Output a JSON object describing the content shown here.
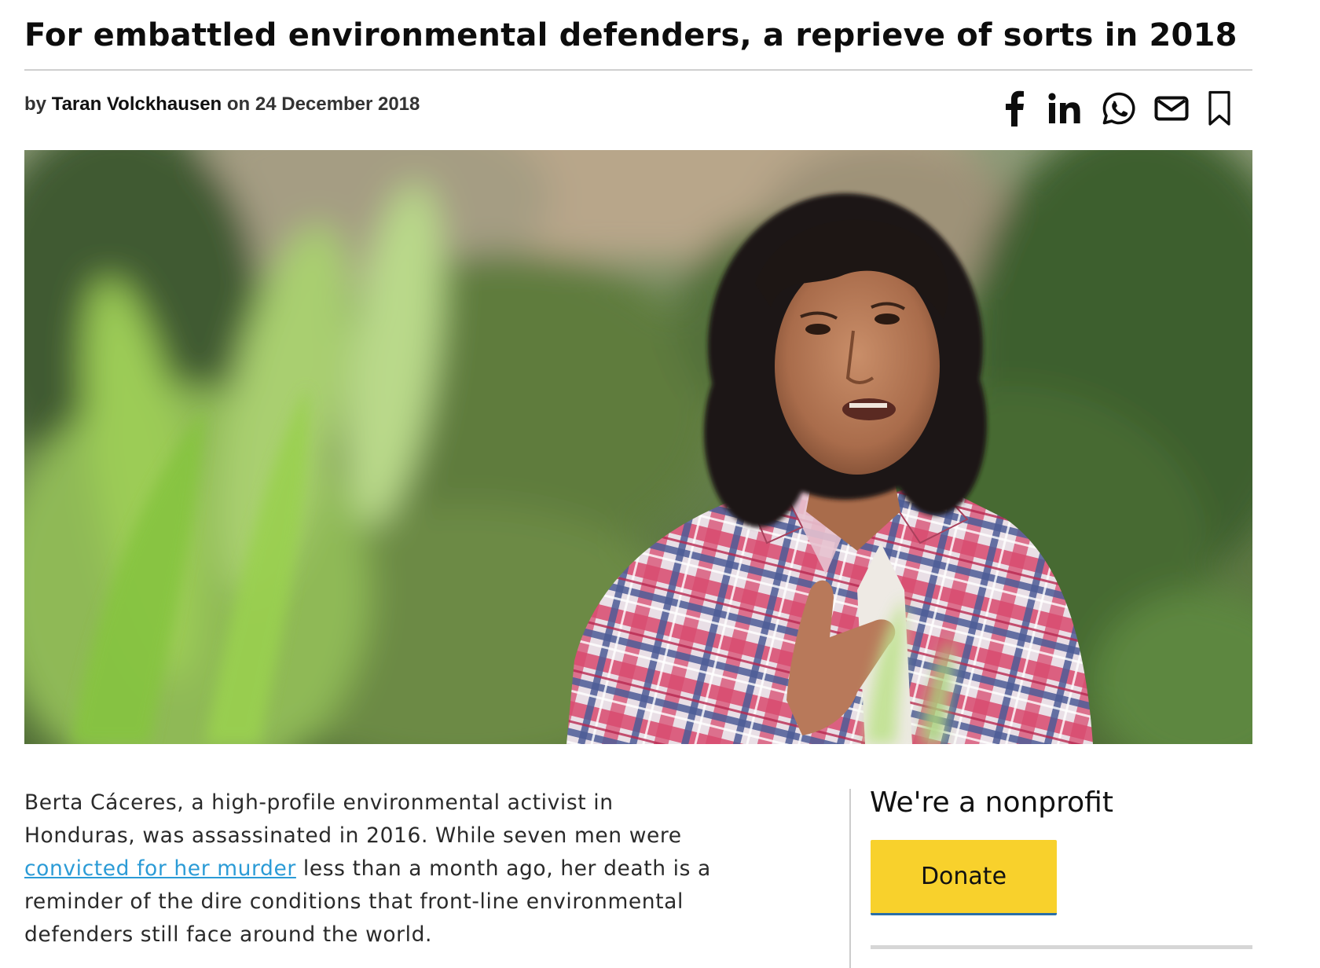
{
  "article": {
    "title": "For embattled environmental defenders, a reprieve of sorts in 2018",
    "byline": {
      "prefix": "by",
      "author": "Taran Volckhausen",
      "on": "on",
      "date": "24 December 2018"
    },
    "hero_image": {
      "alt": "Woman with dark curly hair in a red and blue plaid shirt, speaking outdoors in front of green foliage"
    },
    "body": {
      "part1": "Berta Cáceres, a high-profile environmental activist in Honduras, was assassinated in 2016. While seven men were ",
      "link_text": "convicted for her murder",
      "part2": " less than a month ago, her death is a reminder of the dire conditions that front-line environmental defenders still face around the world."
    }
  },
  "share": {
    "icons": [
      "facebook-icon",
      "linkedin-icon",
      "whatsapp-icon",
      "mail-icon",
      "bookmark-icon"
    ]
  },
  "sidebar": {
    "title": "We're a nonprofit",
    "donate_label": "Donate"
  },
  "colors": {
    "link": "#2b9bd6",
    "donate_bg": "#f8d12c",
    "donate_border": "#2a6ea8"
  }
}
